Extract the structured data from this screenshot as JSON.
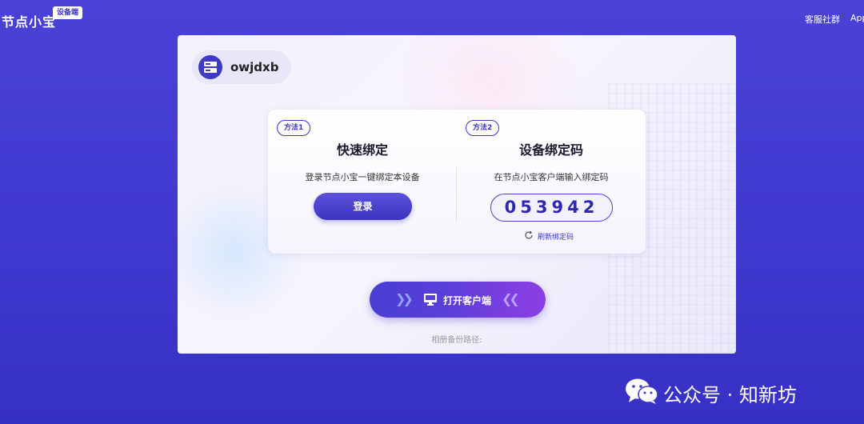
{
  "header": {
    "brand": "节点小宝",
    "badge": "设备端",
    "links": [
      "客服社群",
      "App"
    ]
  },
  "device": {
    "name": "owjdxb"
  },
  "bind": {
    "method1": {
      "tag": "方法1",
      "title": "快速绑定",
      "desc": "登录节点小宝一键绑定本设备",
      "button": "登录"
    },
    "method2": {
      "tag": "方法2",
      "title": "设备绑定码",
      "desc": "在节点小宝客户端输入绑定码",
      "code": "053942",
      "refresh": "刷新绑定码"
    }
  },
  "open_client": {
    "label": "打开客户端"
  },
  "footer": {
    "backup_path": "相册备份路径:"
  },
  "watermark": {
    "text": "公众号 · 知新坊"
  },
  "colors": {
    "accent": "#3d36c2",
    "background": "#4a42d6"
  }
}
